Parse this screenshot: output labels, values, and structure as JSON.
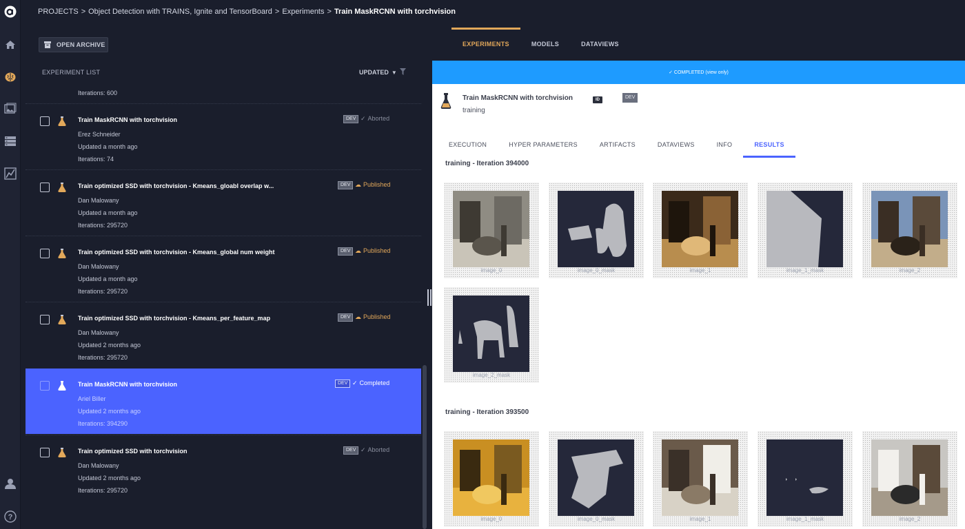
{
  "breadcrumb": {
    "root": "PROJECTS",
    "project": "Object Detection with TRAINS, Ignite and TensorBoard",
    "section": "Experiments",
    "current": "Train MaskRCNN with torchvision",
    "separator": ">"
  },
  "rail": {
    "logo": "a",
    "items": [
      "home-icon",
      "brain-icon",
      "image-icon",
      "database-icon",
      "chart-icon"
    ],
    "bottom": [
      "user-icon",
      "help-icon"
    ]
  },
  "left_panel": {
    "archive_label": "OPEN ARCHIVE",
    "list_title": "EXPERIMENT LIST",
    "sort_label": "UPDATED",
    "partial_row_iterations": "Iterations: 600",
    "experiments": [
      {
        "title": "Train MaskRCNN with torchvision",
        "user": "Erez Schneider",
        "updated": "Updated a month ago",
        "iterations": "Iterations: 74",
        "tag": "DEV",
        "status": "Aborted",
        "status_icon": "✓"
      },
      {
        "title": "Train optimized SSD with torchvision - Kmeans_gloabl overlap w...",
        "user": "Dan Malowany",
        "updated": "Updated a month ago",
        "iterations": "Iterations: 295720",
        "tag": "DEV",
        "status": "Published",
        "status_icon": "☁"
      },
      {
        "title": "Train optimized SSD with torchvision - Kmeans_global num weight",
        "user": "Dan Malowany",
        "updated": "Updated a month ago",
        "iterations": "Iterations: 295720",
        "tag": "DEV",
        "status": "Published",
        "status_icon": "☁"
      },
      {
        "title": "Train optimized SSD with torchvision - Kmeans_per_feature_map",
        "user": "Dan Malowany",
        "updated": "Updated 2 months ago",
        "iterations": "Iterations: 295720",
        "tag": "DEV",
        "status": "Published",
        "status_icon": "☁"
      },
      {
        "title": "Train MaskRCNN with torchvision",
        "user": "Ariel Biller",
        "updated": "Updated 2 months ago",
        "iterations": "Iterations: 394290",
        "tag": "DEV",
        "status": "Completed",
        "status_icon": "✓",
        "selected": true
      },
      {
        "title": "Train optimized SSD with torchvision",
        "user": "Dan Malowany",
        "updated": "Updated 2 months ago",
        "iterations": "Iterations: 295720",
        "tag": "DEV",
        "status": "Aborted",
        "status_icon": "✓"
      }
    ]
  },
  "top_tabs": [
    "EXPERIMENTS",
    "MODELS",
    "DATAVIEWS"
  ],
  "status_bar": "✓ COMPLETED (view only)",
  "detail": {
    "title": "Train MaskRCNN with torchvision",
    "subtitle": "training",
    "id_badge": "ID",
    "tag": "DEV",
    "tabs": [
      "EXECUTION",
      "HYPER PARAMETERS",
      "ARTIFACTS",
      "DATAVIEWS",
      "INFO",
      "RESULTS"
    ],
    "active_tab": "RESULTS",
    "sections": [
      {
        "title": "training - Iteration 394000",
        "images": [
          "image_0",
          "image_0_mask",
          "image_1",
          "image_1_mask",
          "image_2",
          "image_2_mask"
        ]
      },
      {
        "title": "training - Iteration 393500",
        "images": [
          "image_0",
          "image_0_mask",
          "image_1",
          "image_1_mask",
          "image_2"
        ]
      }
    ]
  },
  "colors": {
    "accent": "#4b63ff",
    "orange": "#e2a85a",
    "status_bar": "#1e9bff",
    "background": "#1a1e2c"
  }
}
